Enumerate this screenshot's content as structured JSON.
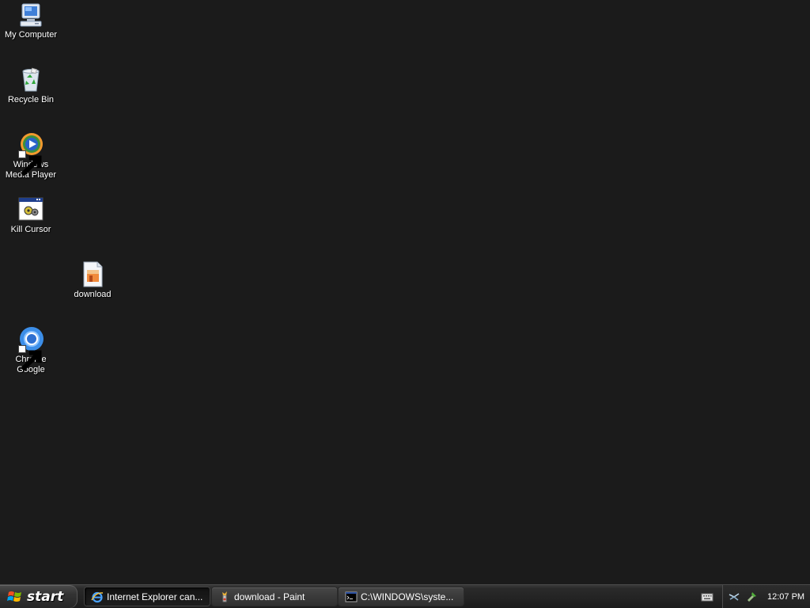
{
  "desktop": {
    "icons": [
      {
        "label": "My Computer",
        "icon": "my-computer-icon"
      },
      {
        "label": "Recycle Bin",
        "icon": "recycle-bin-icon"
      },
      {
        "label": "Windows Media Player",
        "icon": "windows-media-player-icon",
        "shortcut": true
      },
      {
        "label": "Kill Cursor",
        "icon": "kill-cursor-icon"
      },
      {
        "label": "download",
        "icon": "image-file-icon"
      },
      {
        "label": "Chrome Google",
        "icon": "chrome-icon",
        "shortcut": true
      }
    ]
  },
  "taskbar": {
    "start_label": "start",
    "buttons": [
      {
        "label": "Internet Explorer can...",
        "icon": "internet-explorer-icon",
        "active": true
      },
      {
        "label": "download - Paint",
        "icon": "paint-icon",
        "active": false
      },
      {
        "label": "C:\\WINDOWS\\syste...",
        "icon": "command-prompt-icon",
        "active": false
      }
    ],
    "tray": {
      "clock": "12:07 PM",
      "icons": [
        "network-icon",
        "safely-remove-hardware-icon",
        "keyboard-icon"
      ]
    }
  },
  "colors": {
    "desktop_background": "#1b1b1b",
    "taskbar": "#262626",
    "text": "#ffffff"
  }
}
